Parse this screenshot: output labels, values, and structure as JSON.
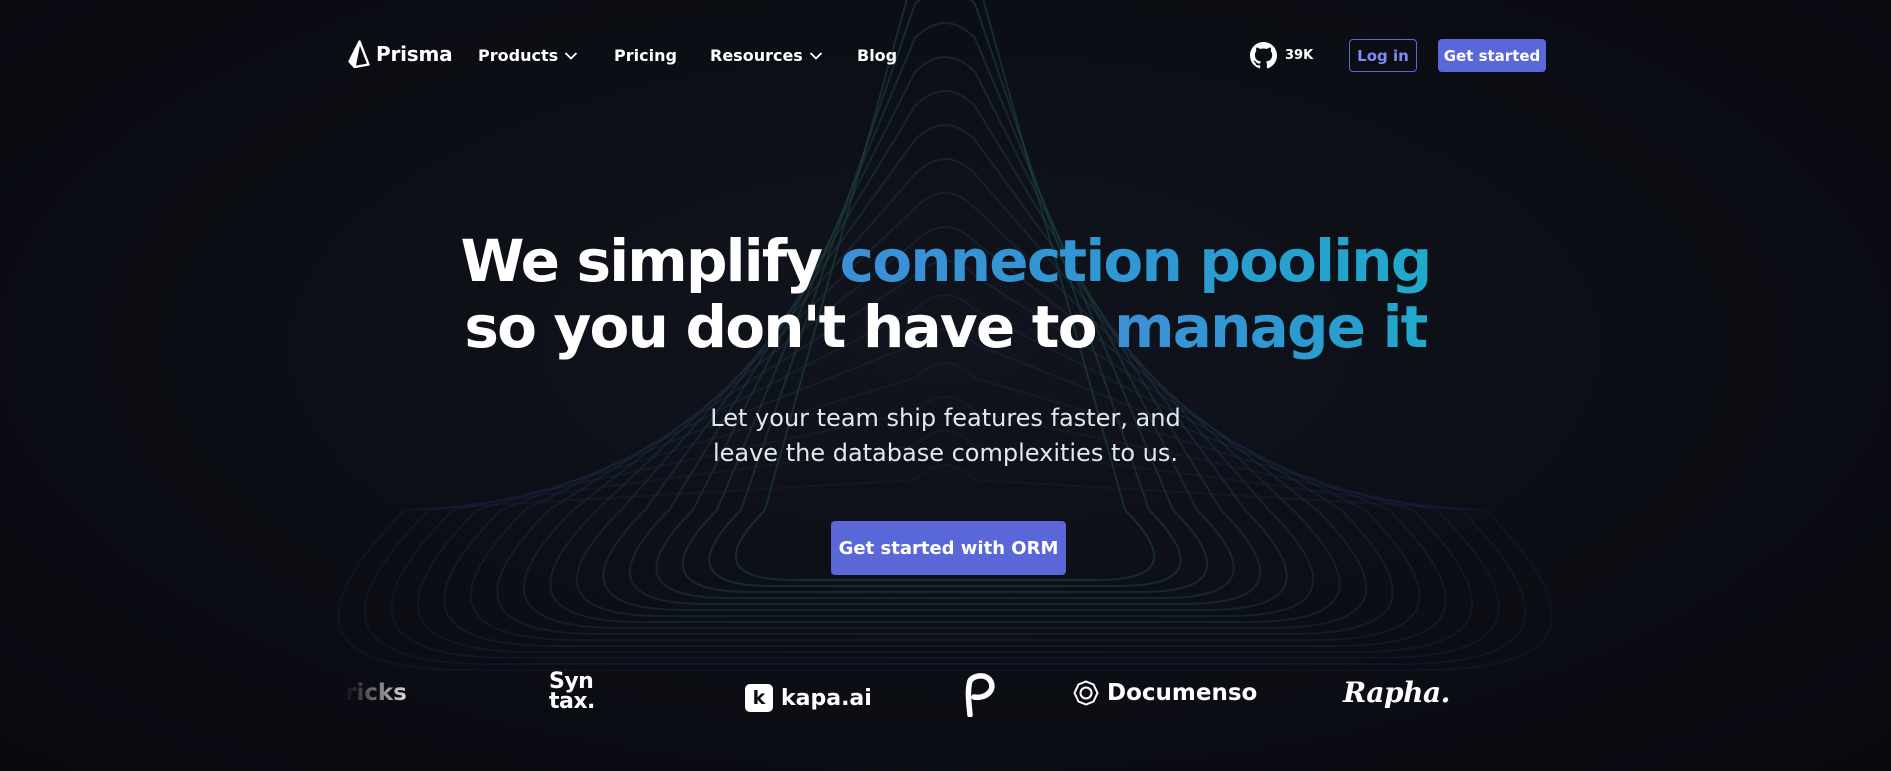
{
  "nav": {
    "brand": "Prisma",
    "links": [
      {
        "label": "Products",
        "has_dropdown": true
      },
      {
        "label": "Pricing",
        "has_dropdown": false
      },
      {
        "label": "Resources",
        "has_dropdown": true
      },
      {
        "label": "Blog",
        "has_dropdown": false
      }
    ],
    "github": {
      "icon": "github-icon",
      "stars": "39K"
    },
    "login_label": "Log in",
    "get_started_label": "Get started"
  },
  "hero": {
    "line1_plain": "We simplify ",
    "line1_highlight": "connection pooling",
    "line2_plain": "so you don't have to ",
    "line2_highlight": "manage it",
    "subtitle_line1": "Let your team ship features faster, and",
    "subtitle_line2": "leave the database complexities to us.",
    "cta_label": "Get started with ORM"
  },
  "customer_logos": [
    {
      "name": "ricks"
    },
    {
      "name_line1": "Syn",
      "name_line2": "tax."
    },
    {
      "name": "kapa.ai",
      "badge": "k"
    },
    {
      "name": "P",
      "icon": "pitch-logo-icon"
    },
    {
      "name": "Documenso",
      "icon": "documenso-logo-icon"
    },
    {
      "name": "Rapha."
    }
  ],
  "colors": {
    "background": "#0b0c13",
    "accent": "#5a67d8",
    "highlight_gradient_start": "#3d8fd6",
    "highlight_gradient_end": "#1faac9"
  }
}
